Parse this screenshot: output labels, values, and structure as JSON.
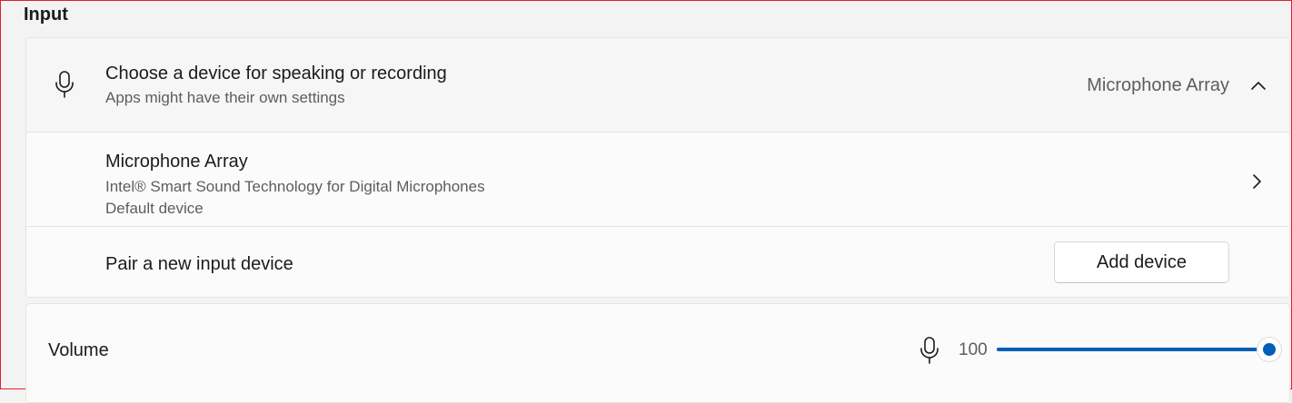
{
  "section": {
    "title": "Input"
  },
  "input_device": {
    "title": "Choose a device for speaking or recording",
    "subtitle": "Apps might have their own settings",
    "selected": "Microphone Array",
    "expanded": true
  },
  "devices": [
    {
      "name": "Microphone Array",
      "driver": "Intel® Smart Sound Technology for Digital Microphones",
      "status": "Default device"
    }
  ],
  "pair": {
    "label": "Pair a new input device",
    "button_label": "Add device"
  },
  "volume": {
    "label": "Volume",
    "value": 100,
    "value_text": "100",
    "max": 100,
    "accent": "#005fb8"
  },
  "icons": {
    "device_icon": "microphone-icon",
    "expand_icon": "chevron-up-icon",
    "device_link_icon": "chevron-right-icon",
    "volume_icon": "microphone-icon"
  }
}
